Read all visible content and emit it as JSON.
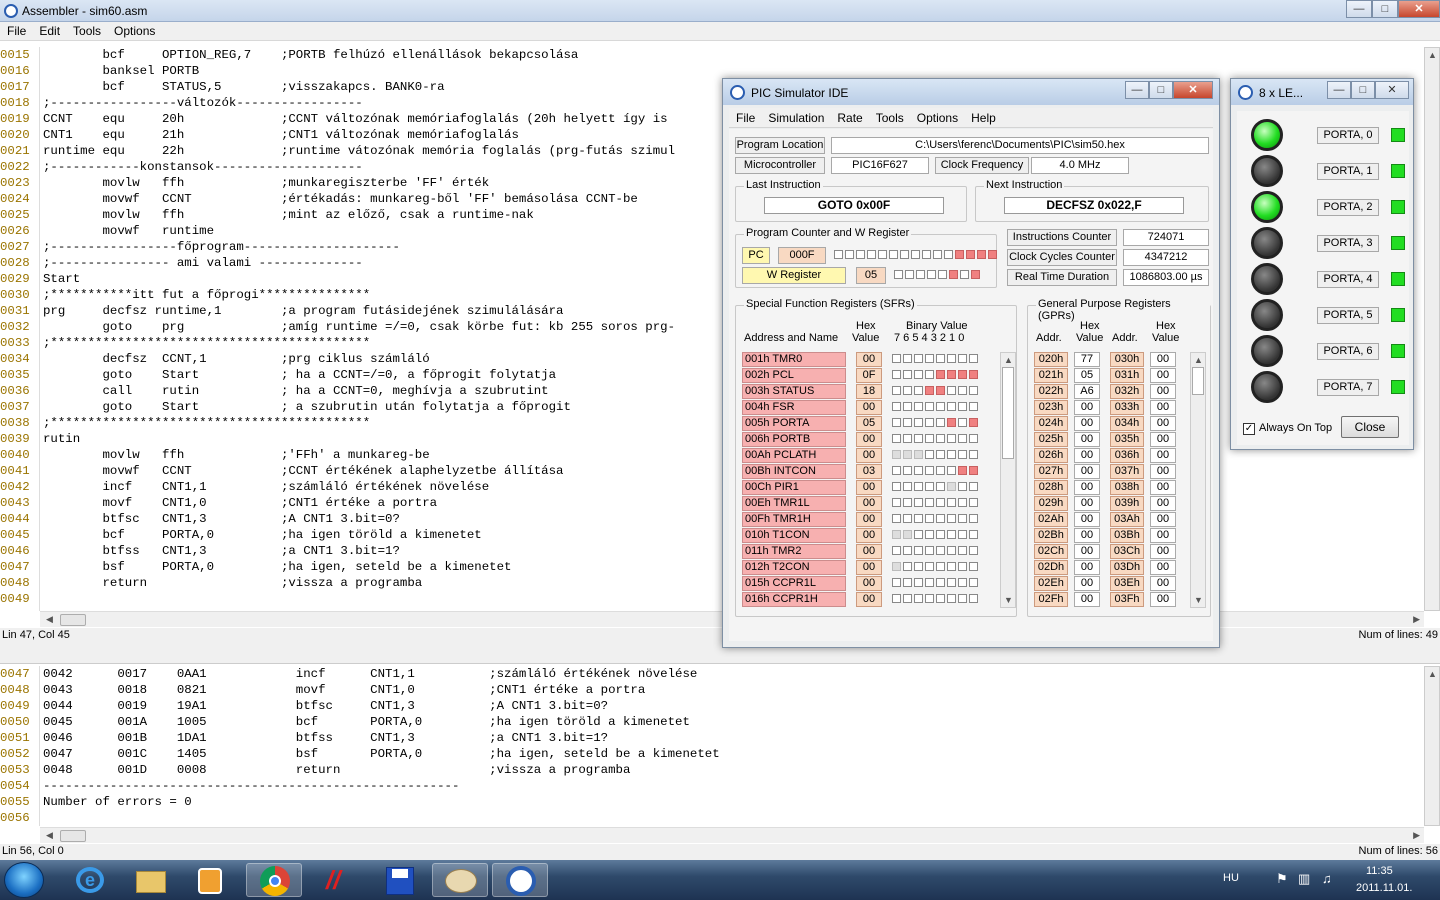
{
  "app": {
    "title": "Assembler - sim60.asm"
  },
  "menu": [
    "File",
    "Edit",
    "Tools",
    "Options"
  ],
  "editor": {
    "lines": [
      {
        "n": "0015",
        "code": "        bcf     OPTION_REG,7    ;PORTB felhúzó ellenállások bekapcsolása"
      },
      {
        "n": "0016",
        "code": "        banksel PORTB"
      },
      {
        "n": "0017",
        "code": "        bcf     STATUS,5        ;visszakapcs. BANK0-ra"
      },
      {
        "n": "0018",
        "code": ";-----------------változók-----------------"
      },
      {
        "n": "0019",
        "code": "CCNT    equ     20h             ;CCNT változónak memóriafoglalás (20h helyett így is"
      },
      {
        "n": "0020",
        "code": "CNT1    equ     21h             ;CNT1 változónak memóriafoglalás"
      },
      {
        "n": "0021",
        "code": "runtime equ     22h             ;runtime vátozónak memória foglalás (prg-futás szimul"
      },
      {
        "n": "0022",
        "code": ";------------konstansok--------------------"
      },
      {
        "n": "0023",
        "code": "        movlw   ffh             ;munkaregiszterbe 'FF' érték"
      },
      {
        "n": "0024",
        "code": "        movwf   CCNT            ;értékadás: munkareg-ből 'FF' bemásolása CCNT-be"
      },
      {
        "n": "0025",
        "code": "        movlw   ffh             ;mint az előző, csak a runtime-nak"
      },
      {
        "n": "0026",
        "code": "        movwf   runtime"
      },
      {
        "n": "0027",
        "code": ";-----------------főprogram---------------------"
      },
      {
        "n": "0028",
        "code": ";---------------- ami valami --------------"
      },
      {
        "n": "0029",
        "code": "Start"
      },
      {
        "n": "0030",
        "code": ";***********itt fut a főprogi***************"
      },
      {
        "n": "0031",
        "code": "prg     decfsz runtime,1        ;a program futásidejének szimulálására"
      },
      {
        "n": "0032",
        "code": "        goto    prg             ;amíg runtime =/=0, csak körbe fut: kb 255 soros prg-"
      },
      {
        "n": "0033",
        "code": ";*******************************************"
      },
      {
        "n": "0034",
        "code": "        decfsz  CCNT,1          ;prg ciklus számláló"
      },
      {
        "n": "0035",
        "code": "        goto    Start           ; ha a CCNT=/=0, a főprogit folytatja"
      },
      {
        "n": "0036",
        "code": "        call    rutin           ; ha a CCNT=0, meghívja a szubrutint"
      },
      {
        "n": "0037",
        "code": "        goto    Start           ; a szubrutin után folytatja a főprogit"
      },
      {
        "n": "0038",
        "code": ";*******************************************"
      },
      {
        "n": "0039",
        "code": "rutin"
      },
      {
        "n": "0040",
        "code": "        movlw   ffh             ;'FFh' a munkareg-be"
      },
      {
        "n": "0041",
        "code": "        movwf   CCNT            ;CCNT értékének alaphelyzetbe állítása"
      },
      {
        "n": "0042",
        "code": "        incf    CNT1,1          ;számláló értékének növelése"
      },
      {
        "n": "0043",
        "code": "        movf    CNT1,0          ;CNT1 értéke a portra"
      },
      {
        "n": "0044",
        "code": "        btfsc   CNT1,3          ;A CNT1 3.bit=0?"
      },
      {
        "n": "0045",
        "code": "        bcf     PORTA,0         ;ha igen töröld a kimenetet"
      },
      {
        "n": "0046",
        "code": "        btfss   CNT1,3          ;a CNT1 3.bit=1?"
      },
      {
        "n": "0047",
        "code": "        bsf     PORTA,0         ;ha igen, seteld be a kimenetet"
      },
      {
        "n": "0048",
        "code": "        return                  ;vissza a programba"
      },
      {
        "n": "0049",
        "code": ""
      }
    ],
    "status_pos": "Lin 47, Col 45",
    "status_lines": "Num of lines: 49"
  },
  "listing": {
    "lines": [
      {
        "n": "0047",
        "code": "0042      0017    0AA1            incf      CNT1,1          ;számláló értékének növelése"
      },
      {
        "n": "0048",
        "code": "0043      0018    0821            movf      CNT1,0          ;CNT1 értéke a portra"
      },
      {
        "n": "0049",
        "code": "0044      0019    19A1            btfsc     CNT1,3          ;A CNT1 3.bit=0?"
      },
      {
        "n": "0050",
        "code": "0045      001A    1005            bcf       PORTA,0         ;ha igen töröld a kimenetet"
      },
      {
        "n": "0051",
        "code": "0046      001B    1DA1            btfss     CNT1,3          ;a CNT1 3.bit=1?"
      },
      {
        "n": "0052",
        "code": "0047      001C    1405            bsf       PORTA,0         ;ha igen, seteld be a kimenetet"
      },
      {
        "n": "0053",
        "code": "0048      001D    0008            return                    ;vissza a programba"
      },
      {
        "n": "0054",
        "code": "--------------------------------------------------------"
      },
      {
        "n": "0055",
        "code": "Number of errors = 0"
      },
      {
        "n": "0056",
        "code": ""
      }
    ],
    "status_pos": "Lin 56, Col 0",
    "status_lines": "Num of lines: 56"
  },
  "sim": {
    "title": "PIC Simulator IDE",
    "menu": [
      "File",
      "Simulation",
      "Rate",
      "Tools",
      "Options",
      "Help"
    ],
    "program_location_label": "Program Location",
    "program_location": "C:\\Users\\ferenc\\Documents\\PIC\\sim50.hex",
    "micro_label": "Microcontroller",
    "micro": "PIC16F627",
    "clock_label": "Clock Frequency",
    "clock": "4.0 MHz",
    "last_instr_label": "Last Instruction",
    "last_instr": "GOTO 0x00F",
    "next_instr_label": "Next Instruction",
    "next_instr": "DECFSZ 0x022,F",
    "pcw_label": "Program Counter and W Register",
    "pc_label": "PC",
    "pc_value": "000F",
    "pc_bits": [
      0,
      0,
      0,
      0,
      0,
      0,
      0,
      0,
      0,
      0,
      0,
      1,
      1,
      1,
      1
    ],
    "w_label": "W Register",
    "w_value": "05",
    "w_bits": [
      0,
      0,
      0,
      0,
      0,
      1,
      0,
      1
    ],
    "instr_counter_label": "Instructions Counter",
    "instr_counter": "724071",
    "cycles_label": "Clock Cycles Counter",
    "cycles": "4347212",
    "rtd_label": "Real Time Duration",
    "rtd": "1086803.00 µs",
    "sfr_title": "Special Function Registers (SFRs)",
    "sfr_h_addr": "Address and Name",
    "sfr_h_hex1": "Hex",
    "sfr_h_hex2": "Value",
    "sfr_h_bin1": "Binary Value",
    "sfr_h_bin2": "7 6 5 4 3 2 1 0",
    "sfrs": [
      {
        "name": "001h  TMR0",
        "hex": "00",
        "bits": [
          0,
          0,
          0,
          0,
          0,
          0,
          0,
          0
        ]
      },
      {
        "name": "002h  PCL",
        "hex": "0F",
        "bits": [
          0,
          0,
          0,
          0,
          1,
          1,
          1,
          1
        ]
      },
      {
        "name": "003h  STATUS",
        "hex": "18",
        "bits": [
          0,
          0,
          0,
          1,
          1,
          0,
          0,
          0
        ]
      },
      {
        "name": "004h  FSR",
        "hex": "00",
        "bits": [
          0,
          0,
          0,
          0,
          0,
          0,
          0,
          0
        ]
      },
      {
        "name": "005h  PORTA",
        "hex": "05",
        "bits": [
          0,
          0,
          0,
          0,
          0,
          1,
          0,
          1
        ]
      },
      {
        "name": "006h  PORTB",
        "hex": "00",
        "bits": [
          0,
          0,
          0,
          0,
          0,
          0,
          0,
          0
        ]
      },
      {
        "name": "00Ah  PCLATH",
        "hex": "00",
        "bits": [
          2,
          2,
          2,
          0,
          0,
          0,
          0,
          0
        ]
      },
      {
        "name": "00Bh  INTCON",
        "hex": "03",
        "bits": [
          0,
          0,
          0,
          0,
          0,
          0,
          1,
          1
        ]
      },
      {
        "name": "00Ch  PIR1",
        "hex": "00",
        "bits": [
          0,
          0,
          0,
          0,
          0,
          2,
          0,
          0
        ]
      },
      {
        "name": "00Eh  TMR1L",
        "hex": "00",
        "bits": [
          0,
          0,
          0,
          0,
          0,
          0,
          0,
          0
        ]
      },
      {
        "name": "00Fh  TMR1H",
        "hex": "00",
        "bits": [
          0,
          0,
          0,
          0,
          0,
          0,
          0,
          0
        ]
      },
      {
        "name": "010h  T1CON",
        "hex": "00",
        "bits": [
          2,
          2,
          0,
          0,
          0,
          0,
          0,
          0
        ]
      },
      {
        "name": "011h  TMR2",
        "hex": "00",
        "bits": [
          0,
          0,
          0,
          0,
          0,
          0,
          0,
          0
        ]
      },
      {
        "name": "012h  T2CON",
        "hex": "00",
        "bits": [
          2,
          0,
          0,
          0,
          0,
          0,
          0,
          0
        ]
      },
      {
        "name": "015h  CCPR1L",
        "hex": "00",
        "bits": [
          0,
          0,
          0,
          0,
          0,
          0,
          0,
          0
        ]
      },
      {
        "name": "016h  CCPR1H",
        "hex": "00",
        "bits": [
          0,
          0,
          0,
          0,
          0,
          0,
          0,
          0
        ]
      }
    ],
    "gpr_title": "General Purpose Registers (GPRs)",
    "gpr_h_addr": "Addr.",
    "gpr_h_hex1": "Hex",
    "gpr_h_hex2": "Value",
    "gprs": [
      {
        "a1": "020h",
        "v1": "77",
        "a2": "030h",
        "v2": "00"
      },
      {
        "a1": "021h",
        "v1": "05",
        "a2": "031h",
        "v2": "00"
      },
      {
        "a1": "022h",
        "v1": "A6",
        "a2": "032h",
        "v2": "00"
      },
      {
        "a1": "023h",
        "v1": "00",
        "a2": "033h",
        "v2": "00"
      },
      {
        "a1": "024h",
        "v1": "00",
        "a2": "034h",
        "v2": "00"
      },
      {
        "a1": "025h",
        "v1": "00",
        "a2": "035h",
        "v2": "00"
      },
      {
        "a1": "026h",
        "v1": "00",
        "a2": "036h",
        "v2": "00"
      },
      {
        "a1": "027h",
        "v1": "00",
        "a2": "037h",
        "v2": "00"
      },
      {
        "a1": "028h",
        "v1": "00",
        "a2": "038h",
        "v2": "00"
      },
      {
        "a1": "029h",
        "v1": "00",
        "a2": "039h",
        "v2": "00"
      },
      {
        "a1": "02Ah",
        "v1": "00",
        "a2": "03Ah",
        "v2": "00"
      },
      {
        "a1": "02Bh",
        "v1": "00",
        "a2": "03Bh",
        "v2": "00"
      },
      {
        "a1": "02Ch",
        "v1": "00",
        "a2": "03Ch",
        "v2": "00"
      },
      {
        "a1": "02Dh",
        "v1": "00",
        "a2": "03Dh",
        "v2": "00"
      },
      {
        "a1": "02Eh",
        "v1": "00",
        "a2": "03Eh",
        "v2": "00"
      },
      {
        "a1": "02Fh",
        "v1": "00",
        "a2": "03Fh",
        "v2": "00"
      }
    ]
  },
  "leds": {
    "title": "8 x LE...",
    "items": [
      {
        "label": "PORTA, 0",
        "on": true
      },
      {
        "label": "PORTA, 1",
        "on": false
      },
      {
        "label": "PORTA, 2",
        "on": true
      },
      {
        "label": "PORTA, 3",
        "on": false
      },
      {
        "label": "PORTA, 4",
        "on": false
      },
      {
        "label": "PORTA, 5",
        "on": false
      },
      {
        "label": "PORTA, 6",
        "on": false
      },
      {
        "label": "PORTA, 7",
        "on": false
      }
    ],
    "always_on_top": "Always On Top",
    "close": "Close"
  },
  "taskbar": {
    "icons": [
      "start-orb-icon",
      "internet-explorer-icon",
      "file-explorer-icon",
      "media-player-icon",
      "chrome-icon",
      "game-icon",
      "save-disk-icon",
      "paint-icon",
      "pic-simulator-icon"
    ],
    "lang": "HU",
    "time": "11:35",
    "date": "2011.11.01."
  },
  "colors": {
    "sfr_name": "#f7b0b0",
    "bit_on": "#f08080",
    "led_on": "#22dd22"
  }
}
